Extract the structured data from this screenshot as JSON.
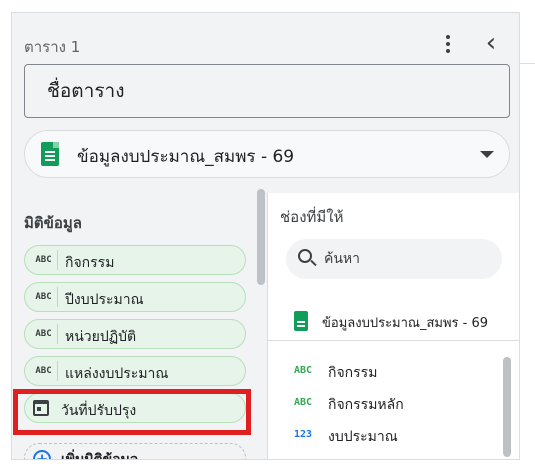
{
  "header": {
    "title": "ตาราง 1"
  },
  "table_name": {
    "placeholder": "ชื่อตาราง"
  },
  "data_source": {
    "selected": "ข้อมูลงบประมาณ_สมพร - 69"
  },
  "dimensions": {
    "title": "มิติข้อมูล",
    "items": [
      {
        "type": "ABC",
        "label": "กิจกรรม"
      },
      {
        "type": "ABC",
        "label": "ปีงบประมาณ"
      },
      {
        "type": "ABC",
        "label": "หน่วยปฏิบัติ"
      },
      {
        "type": "ABC",
        "label": "แหล่งงบประมาณ"
      },
      {
        "type": "calendar-icon",
        "label": "วันที่ปรับปรุง"
      }
    ],
    "add_label": "เพิ่มมิติข้อมูล"
  },
  "available_fields": {
    "title": "ช่องที่มีให้",
    "search_placeholder": "ค้นหา",
    "data_source_label": "ข้อมูลงบประมาณ_สมพร - 69",
    "fields": [
      {
        "type": "ABC",
        "name": "กิจกรรม"
      },
      {
        "type": "ABC",
        "name": "กิจกรรมหลัก"
      },
      {
        "type": "123",
        "name": "งบประมาณ"
      }
    ]
  },
  "colors": {
    "highlight": "#e02020",
    "chip_background": "#e6f4ea",
    "sheets_green": "#0f9d58",
    "accent_blue": "#1a73e8"
  }
}
